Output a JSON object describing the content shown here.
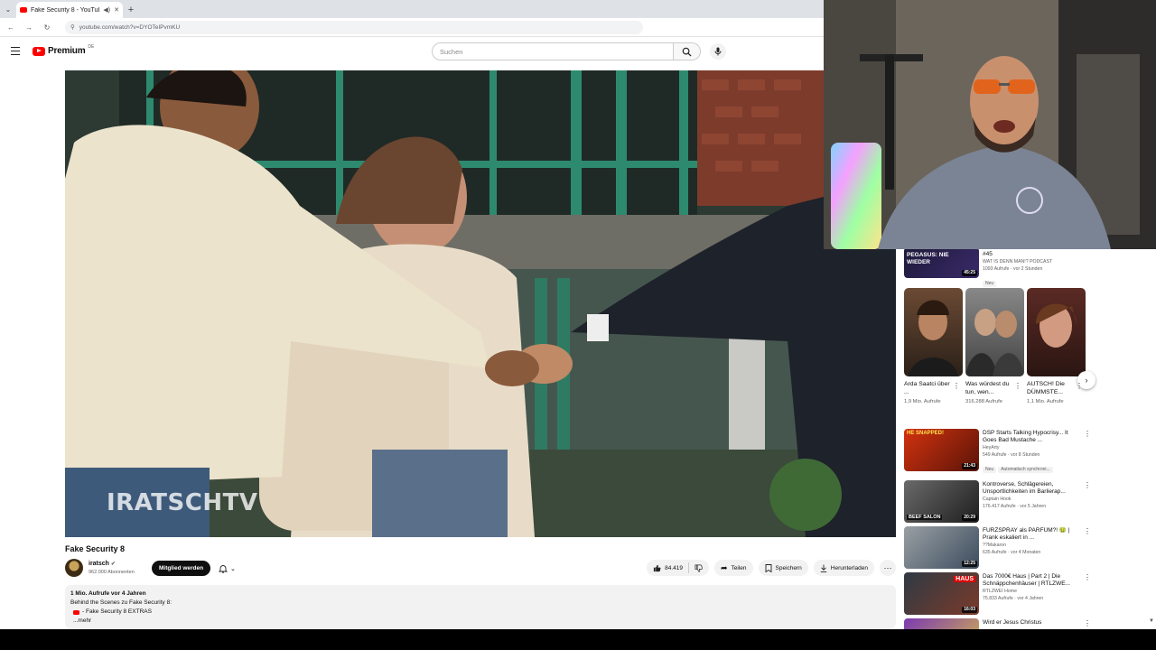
{
  "browser": {
    "tab_title": "Fake Security 8 - YouTube",
    "url": "youtube.com/watch?v=DYOTeIPvmKU"
  },
  "header": {
    "logo_text": "Premium",
    "logo_region": "DE",
    "search_placeholder": "Suchen"
  },
  "video": {
    "watermark": "IRATSCHTV",
    "title": "Fake Security 8"
  },
  "channel": {
    "name": "iratsch",
    "subscribers": "962.000 Abonnenten",
    "member_label": "Mitglied werden"
  },
  "actions": {
    "likes": "84.419",
    "share_label": "Teilen",
    "save_label": "Speichern",
    "download_label": "Herunterladen"
  },
  "description": {
    "meta": "1 Mio. Aufrufe  vor 4 Jahren",
    "line1": "Behind the Scenes zu Fake Security 8:",
    "extras": "- Fake Security 8 EXTRAS",
    "more": "...mehr"
  },
  "sidebar": {
    "top_item": {
      "thumb_text": "PEGASUS: NIE WIEDER",
      "duration": "45:25",
      "title": "Was ist DENN MAN!? Podcast #45",
      "channel": "WAT IS DENN MAN!? PODCAST",
      "stats": "1093 Aufrufe · vor 2 Stunden",
      "badge": "Neu"
    },
    "shorts": [
      {
        "title": "Arda Saatci über ...",
        "views": "1,9 Mio. Aufrufe"
      },
      {
        "title": "Was würdest du tun, wen...",
        "views": "316.288 Aufrufe"
      },
      {
        "title": "AUTSCH! Die DÜMMSTE...",
        "views": "1,1 Mio. Aufrufe"
      }
    ],
    "videos": [
      {
        "thumb_text": "HE SNAPPED!",
        "duration": "21:43",
        "title": "DSP Starts Talking Hypocrisy... It Goes Bad Mustache ...",
        "channel": "HeyArty",
        "stats": "549 Aufrufe · vor 8 Stunden",
        "badges": [
          "Neu",
          "Automatisch synchroni..."
        ]
      },
      {
        "thumb_text": "BEEF SALON",
        "duration": "20:29",
        "title": "Kontroverse, Schlägereien, Unsportlichkeiten im Barlierap...",
        "channel": "Captain Hook",
        "stats": "176.417 Aufrufe · vor 5 Jahren",
        "badges": []
      },
      {
        "thumb_text": "",
        "duration": "12:25",
        "title": "FURZSPRAY als PARFÜM?! 🤢 | Prank eskaliert in ...",
        "channel": "??Makaron",
        "stats": "635 Aufrufe · vor 4 Monaten",
        "badges": []
      },
      {
        "thumb_text": "HAUS",
        "duration": "16:03",
        "title": "Das 7000€ Haus | Part 2 | Die Schnäppchenhäuser | RTLZWE...",
        "channel": "RTLZWEI Home",
        "stats": "75.833 Aufrufe · vor 4 Jahren",
        "badges": []
      },
      {
        "thumb_text": "",
        "duration": "",
        "title": "Wird er Jesus Christus",
        "channel": "",
        "stats": "",
        "badges": []
      }
    ]
  },
  "colors": {
    "accent": "#ff0000",
    "text": "#0f0f0f",
    "muted": "#606060"
  }
}
